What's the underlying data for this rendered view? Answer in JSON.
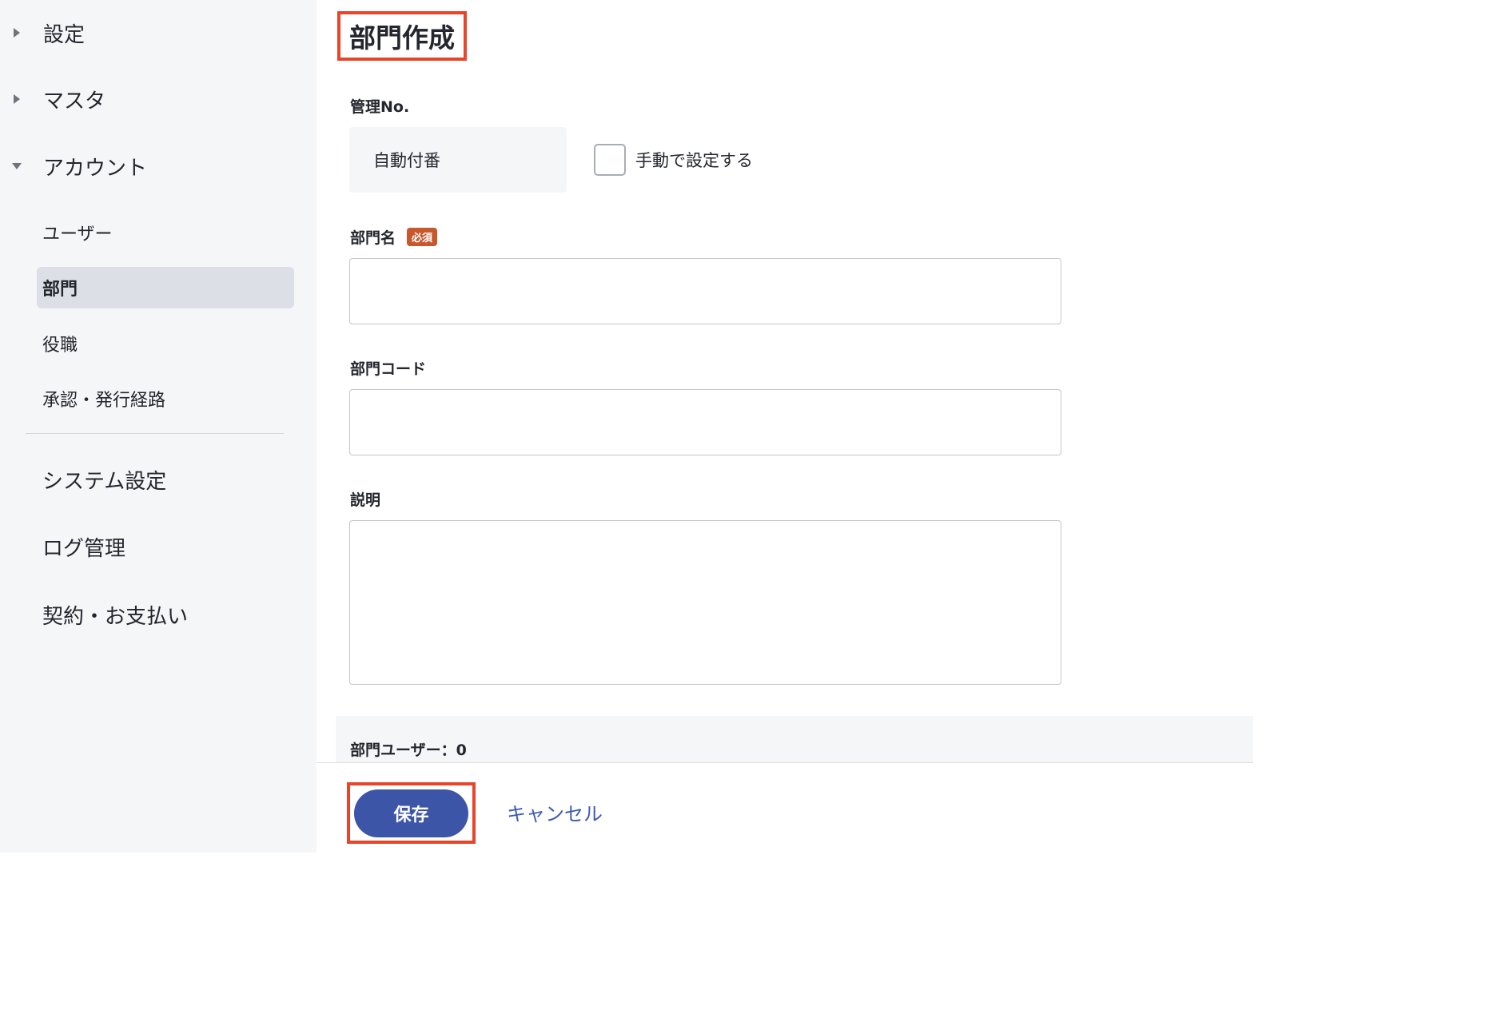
{
  "sidebar": {
    "settings": "設定",
    "master": "マスタ",
    "account": "アカウント",
    "account_children": {
      "users": "ユーザー",
      "departments": "部門",
      "positions": "役職",
      "approval_routes": "承認・発行経路"
    },
    "system_settings": "システム設定",
    "log_management": "ログ管理",
    "contract_payment": "契約・お支払い"
  },
  "main": {
    "page_title": "部門作成",
    "management_no": {
      "label": "管理No.",
      "value": "自動付番",
      "manual_checkbox_label": "手動で設定する",
      "manual_checked": false
    },
    "department_name": {
      "label": "部門名",
      "required_badge": "必須",
      "value": ""
    },
    "department_code": {
      "label": "部門コード",
      "value": ""
    },
    "description": {
      "label": "説明",
      "value": ""
    },
    "department_users": "部門ユーザー：0"
  },
  "footer": {
    "save_label": "保存",
    "cancel_label": "キャンセル"
  },
  "colors": {
    "primary": "#3d55a6",
    "link": "#3b5ab4",
    "highlight": "#e8442a",
    "required": "#c8572c",
    "sidebar_bg": "#f5f6f8"
  }
}
